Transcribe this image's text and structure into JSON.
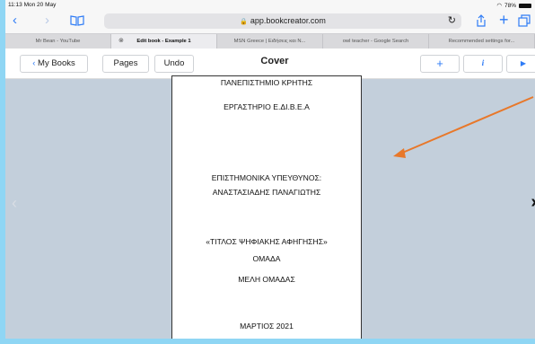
{
  "status_bar": {
    "time": "11:13  Mon 20 May",
    "battery": "78%"
  },
  "safari": {
    "url": "app.bookcreator.com",
    "reload_icon": "↻",
    "icons": [
      "chevron-left-icon",
      "chevron-right-icon",
      "book-icon",
      "share-icon",
      "plus-icon",
      "tabs-icon"
    ]
  },
  "tabs": [
    {
      "label": "Mr Bean - YouTube",
      "active": false
    },
    {
      "label": "Edit book - Example 1",
      "active": true
    },
    {
      "label": "MSN Greece | Ειδήσεις και N...",
      "active": false
    },
    {
      "label": "owl teacher - Google Search",
      "active": false
    },
    {
      "label": "Recommended settings for...",
      "active": false
    }
  ],
  "toolbar": {
    "my_books": "My Books",
    "pages": "Pages",
    "undo": "Undo",
    "title": "Cover",
    "add": "+",
    "info": "i",
    "play": "▶"
  },
  "page": {
    "line1": "ΠΑΝΕΠΙΣΤΗΜΙΟ ΚΡΗΤΗΣ",
    "line2": "ΕΡΓΑΣΤΗΡΙΟ Ε.ΔΙ.Β.Ε.Α",
    "line3": "ΕΠΙΣΤΗΜΟΝΙΚΑ ΥΠΕΥΘΥΝΟΣ:",
    "line4": "ΑΝΑΣΤΑΣΙΑΔΗΣ ΠΑΝΑΓΙΩΤΗΣ",
    "line5": "«ΤΙΤΛΟΣ ΨΗΦΙΑΚΗΣ ΑΦΗΓΗΣΗΣ»",
    "line6": "ΟΜΑΔΑ",
    "line7": "ΜΕΛΗ ΟΜΑΔΑΣ",
    "line8": "ΜΑΡΤΙΟΣ 2021"
  },
  "colors": {
    "accent": "#2f7cf6",
    "annotation_arrow": "#e8782a",
    "frame": "#8fd6f4",
    "canvas": "#c3cfdb"
  }
}
